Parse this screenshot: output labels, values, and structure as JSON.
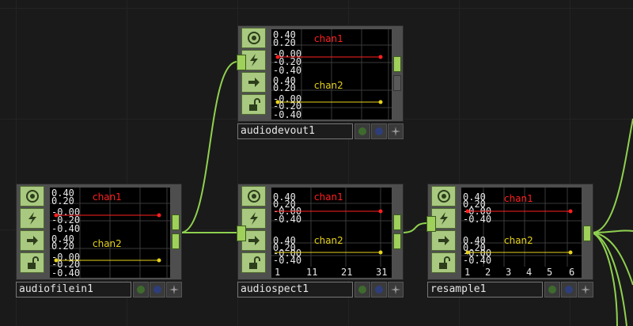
{
  "colors": {
    "wire": "#8fd14f",
    "chan1": "#ff1f1f",
    "chan2": "#e6d21a",
    "flag": "#a8c97f",
    "node_body": "#4e4e4e"
  },
  "nodes": {
    "audiodevout": {
      "name": "audiodevout1",
      "ticks": [
        "0.40",
        "0.20",
        "-0.00",
        "-0.20",
        "-0.40"
      ],
      "chan1_label": "chan1",
      "chan2_label": "chan2",
      "xticks": []
    },
    "audiofilein": {
      "name": "audiofilein1",
      "ticks": [
        "0.40",
        "0.20",
        "-0.00",
        "-0.20",
        "-0.40"
      ],
      "chan1_label": "chan1",
      "chan2_label": "chan2",
      "xticks": []
    },
    "audiospect": {
      "name": "audiospect1",
      "ticks": [
        "0.40",
        "0.20",
        "-0.00",
        "-0.20",
        "-0.40"
      ],
      "chan1_label": "chan1",
      "chan2_label": "chan2",
      "xticks": [
        "1",
        "11",
        "21",
        "31"
      ]
    },
    "resample": {
      "name": "resample1",
      "ticks": [
        "0.40",
        "0.20",
        "-0.00",
        "-0.20",
        "-0.40"
      ],
      "chan1_label": "chan1",
      "chan2_label": "chan2",
      "xticks": [
        "1",
        "2",
        "3",
        "4",
        "5",
        "6"
      ]
    }
  },
  "icons": [
    "viewer-active-icon",
    "bypass-icon",
    "display-flag-icon",
    "lock-icon",
    "cook-icon",
    "info-icon",
    "pin-icon"
  ]
}
